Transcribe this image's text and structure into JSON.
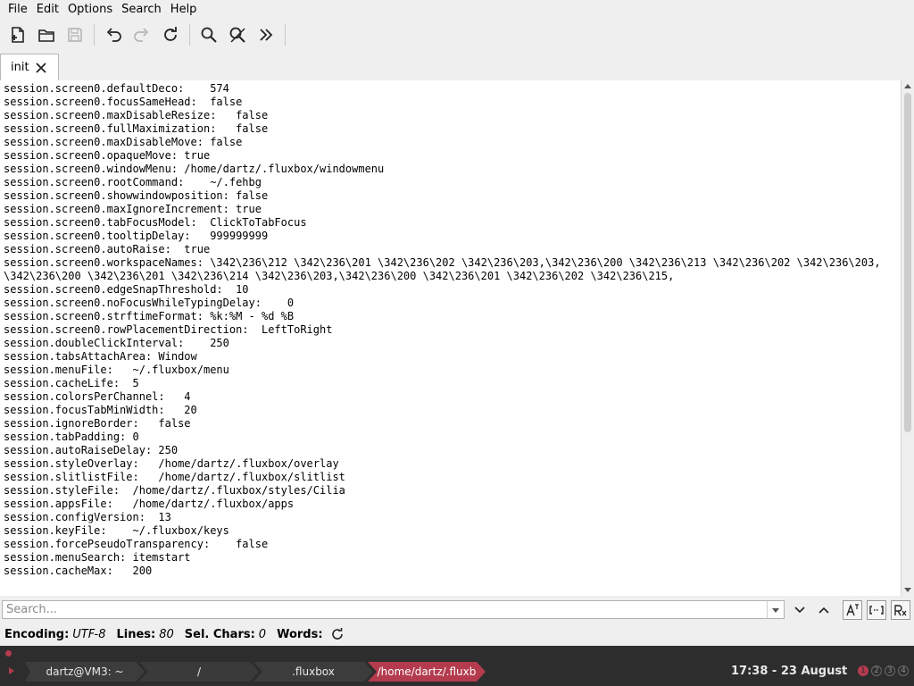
{
  "menu": [
    "File",
    "Edit",
    "Options",
    "Search",
    "Help"
  ],
  "tab": {
    "label": "init"
  },
  "lines": [
    "session.screen0.defaultDeco:    574",
    "session.screen0.focusSameHead:  false",
    "session.screen0.maxDisableResize:   false",
    "session.screen0.fullMaximization:   false",
    "session.screen0.maxDisableMove: false",
    "session.screen0.opaqueMove: true",
    "session.screen0.windowMenu: /home/dartz/.fluxbox/windowmenu",
    "session.screen0.rootCommand:    ~/.fehbg",
    "session.screen0.showwindowposition: false",
    "session.screen0.maxIgnoreIncrement: true",
    "session.screen0.tabFocusModel:  ClickToTabFocus",
    "session.screen0.tooltipDelay:   999999999",
    "session.screen0.autoRaise:  true",
    "session.screen0.workspaceNames: \\342\\236\\212 \\342\\236\\201 \\342\\236\\202 \\342\\236\\203,\\342\\236\\200 \\342\\236\\213 \\342\\236\\202 \\342\\236\\203,",
    "\\342\\236\\200 \\342\\236\\201 \\342\\236\\214 \\342\\236\\203,\\342\\236\\200 \\342\\236\\201 \\342\\236\\202 \\342\\236\\215,",
    "session.screen0.edgeSnapThreshold:  10",
    "session.screen0.noFocusWhileTypingDelay:    0",
    "session.screen0.strftimeFormat: %k:%M - %d %B",
    "session.screen0.rowPlacementDirection:  LeftToRight",
    "session.doubleClickInterval:    250",
    "session.tabsAttachArea: Window",
    "session.menuFile:   ~/.fluxbox/menu",
    "session.cacheLife:  5",
    "session.colorsPerChannel:   4",
    "session.focusTabMinWidth:   20",
    "session.ignoreBorder:   false",
    "session.tabPadding: 0",
    "session.autoRaiseDelay: 250",
    "session.styleOverlay:   /home/dartz/.fluxbox/overlay",
    "session.slitlistFile:   /home/dartz/.fluxbox/slitlist",
    "session.styleFile:  /home/dartz/.fluxbox/styles/Cilia",
    "session.appsFile:   /home/dartz/.fluxbox/apps",
    "session.configVersion:  13",
    "session.keyFile:    ~/.fluxbox/keys",
    "session.forcePseudoTransparency:    false",
    "session.menuSearch: itemstart",
    "session.cacheMax:   200"
  ],
  "search": {
    "placeholder": "Search...",
    "value": ""
  },
  "status": {
    "encoding_label": "Encoding:",
    "encoding_value": "UTF-8",
    "lines_label": "Lines:",
    "lines_value": "80",
    "selchars_label": "Sel. Chars:",
    "selchars_value": "0",
    "words_label": "Words:"
  },
  "panel": {
    "segments": [
      "dartz@VM3: ~",
      "/",
      ".fluxbox",
      "/home/dartz/.fluxb"
    ],
    "clock": "17:38 - 23 August",
    "workspaces": [
      "1",
      "2",
      "3",
      "4"
    ],
    "accent": "#b33b4d"
  }
}
